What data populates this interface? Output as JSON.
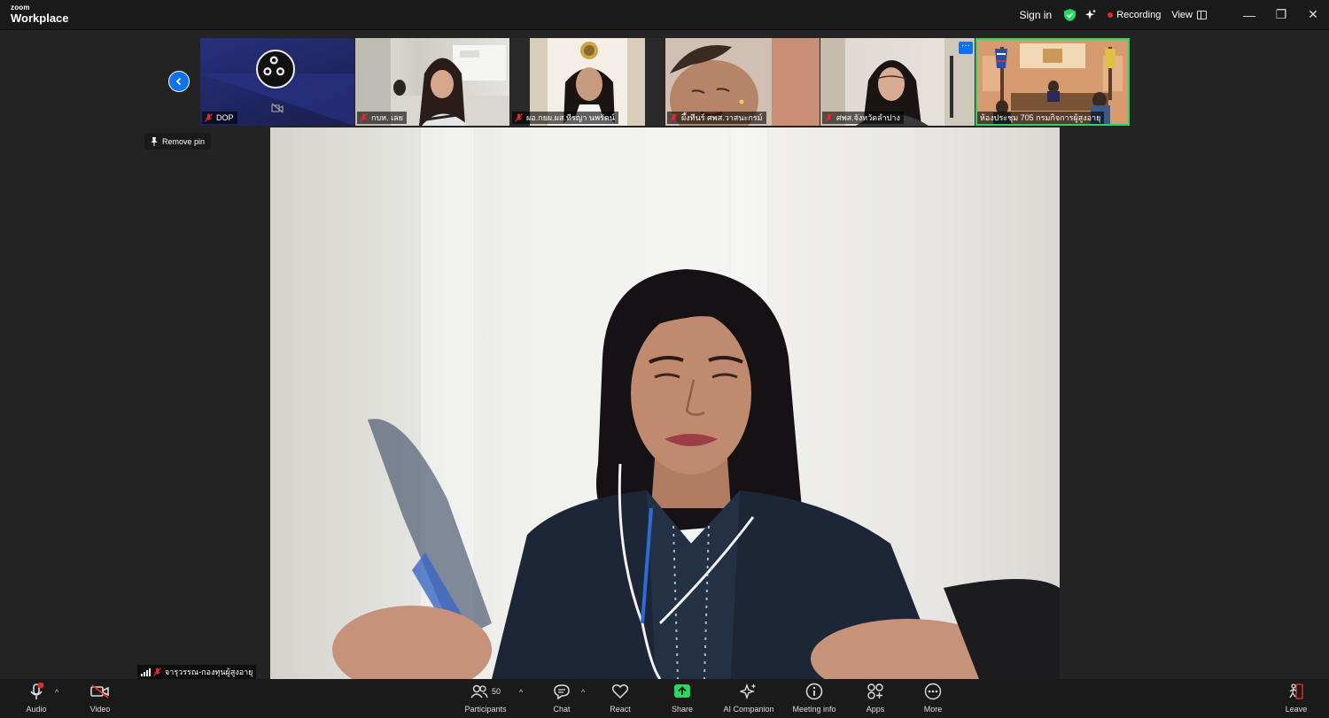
{
  "app": {
    "brand_small": "zoom",
    "brand_name": "Workplace"
  },
  "titlebar": {
    "signin_label": "Sign in",
    "recording_label": "Recording",
    "view_label": "View",
    "minimize_glyph": "—",
    "restore_glyph": "❐",
    "close_glyph": "✕"
  },
  "thumbnails": [
    {
      "name": "DOP"
    },
    {
      "name": "กบห. เลย"
    },
    {
      "name": "ผอ.กยผ.ผส.ทีรญา นพรัตน์"
    },
    {
      "name": "ผึ้งทีนร์ ศพส.วาสนะกรม์"
    },
    {
      "name": "ศพส.จังหวัดลำปาง"
    },
    {
      "name": "ห้องประชุม 705 กรมกิจการผู้สูงอายุ"
    }
  ],
  "more_badge": "···",
  "remove_pin_label": "Remove pin",
  "main_video": {
    "participant_name": "จารุวรรณ-กองทุนผู้สูงอายุ"
  },
  "toolbar": {
    "audio_label": "Audio",
    "video_label": "Video",
    "participants_label": "Participants",
    "participants_count": "50",
    "chat_label": "Chat",
    "react_label": "React",
    "share_label": "Share",
    "ai_companion_label": "AI Companion",
    "meeting_info_label": "Meeting info",
    "apps_label": "Apps",
    "more_label": "More",
    "leave_label": "Leave"
  },
  "colors": {
    "accent_blue": "#0e72ed",
    "active_speaker_green": "#23d960",
    "share_green": "#23d960",
    "recording_red": "#e02a2a",
    "muted_red": "#e02a2a"
  },
  "icons": [
    "shield-icon",
    "ai-spark-icon",
    "view-grid-icon",
    "chevron-left-icon",
    "mic-muted-icon",
    "camera-off-icon",
    "pin-icon",
    "signal-icon",
    "microphone-icon",
    "video-icon",
    "participants-icon",
    "chat-icon",
    "react-heart-icon",
    "share-arrow-icon",
    "ai-companion-icon",
    "info-icon",
    "apps-icon",
    "more-dots-icon",
    "leave-icon"
  ]
}
